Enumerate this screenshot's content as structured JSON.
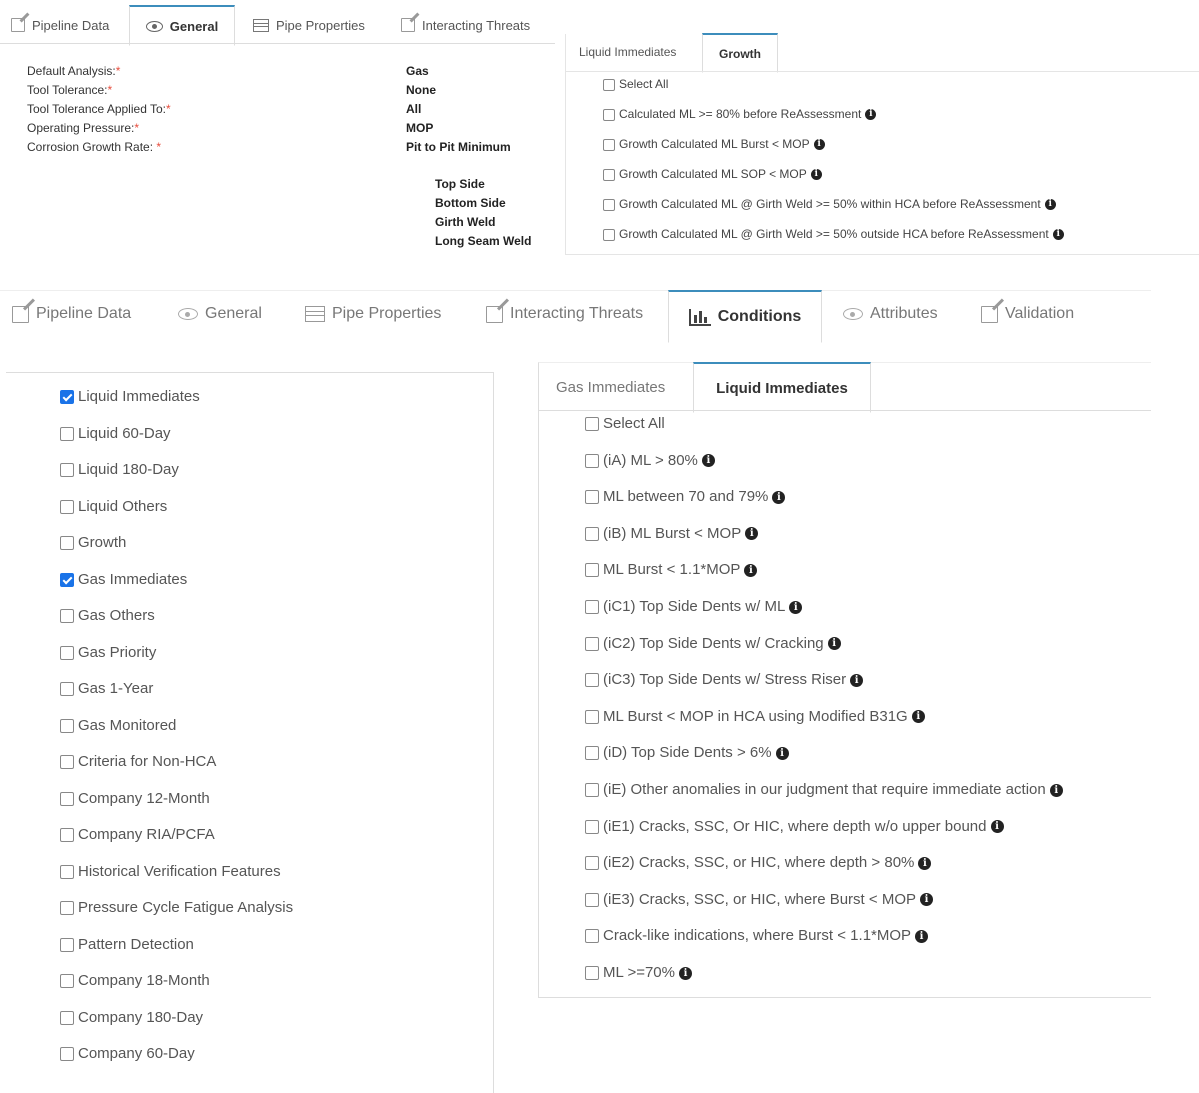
{
  "top_tabs": [
    "Pipeline Data",
    "General",
    "Pipe Properties",
    "Interacting Threats"
  ],
  "general_fields": [
    {
      "label": "Default Analysis:",
      "req": "*",
      "value": "Gas"
    },
    {
      "label": "Tool Tolerance:",
      "req": "*",
      "value": "None"
    },
    {
      "label": "Tool Tolerance Applied To:",
      "req": "*",
      "value": "All"
    },
    {
      "label": "Operating Pressure:",
      "req": "*",
      "value": "MOP"
    },
    {
      "label": "Corrosion Growth Rate: ",
      "req": "*",
      "value": "Pit to Pit Minimum"
    }
  ],
  "general_sub_values": [
    "Top Side",
    "Bottom Side",
    "Girth Weld",
    "Long Seam Weld"
  ],
  "growth_tabs": [
    "Liquid Immediates",
    "Growth"
  ],
  "growth_items": [
    "Select All",
    "Calculated ML >= 80% before ReAssessment",
    "Growth Calculated ML Burst < MOP",
    "Growth Calculated ML SOP < MOP",
    "Growth Calculated ML @ Girth Weld >= 50% within HCA before ReAssessment",
    "Growth Calculated ML @ Girth Weld >= 50% outside HCA before ReAssessment"
  ],
  "main_tabs": [
    "Pipeline Data",
    "General",
    "Pipe Properties",
    "Interacting Threats",
    "Conditions",
    "Attributes",
    "Validation"
  ],
  "conditions": [
    {
      "label": "Liquid Immediates",
      "checked": true
    },
    {
      "label": "Liquid 60-Day",
      "checked": false
    },
    {
      "label": "Liquid 180-Day",
      "checked": false
    },
    {
      "label": "Liquid Others",
      "checked": false
    },
    {
      "label": "Growth",
      "checked": false
    },
    {
      "label": "Gas Immediates",
      "checked": true
    },
    {
      "label": "Gas Others",
      "checked": false
    },
    {
      "label": "Gas Priority",
      "checked": false
    },
    {
      "label": "Gas 1-Year",
      "checked": false
    },
    {
      "label": "Gas Monitored",
      "checked": false
    },
    {
      "label": "Criteria for Non-HCA",
      "checked": false
    },
    {
      "label": "Company 12-Month",
      "checked": false
    },
    {
      "label": "Company RIA/PCFA",
      "checked": false
    },
    {
      "label": "Historical Verification Features",
      "checked": false
    },
    {
      "label": "Pressure Cycle Fatigue Analysis",
      "checked": false
    },
    {
      "label": "Pattern Detection",
      "checked": false
    },
    {
      "label": "Company 18-Month",
      "checked": false
    },
    {
      "label": "Company 180-Day",
      "checked": false
    },
    {
      "label": "Company 60-Day",
      "checked": false
    }
  ],
  "liquid_tabs": [
    "Gas Immediates",
    "Liquid Immediates"
  ],
  "liquid_items": [
    "Select All",
    "(iA) ML > 80%",
    "ML between 70 and 79%",
    "(iB) ML Burst < MOP",
    "ML Burst < 1.1*MOP",
    "(iC1) Top Side Dents w/ ML",
    "(iC2) Top Side Dents w/ Cracking",
    "(iC3) Top Side Dents w/ Stress Riser",
    "ML Burst < MOP in HCA using Modified B31G",
    "(iD) Top Side Dents > 6%",
    "(iE) Other anomalies in our judgment that require immediate action",
    "(iE1) Cracks, SSC, Or HIC, where depth w/o upper bound",
    "(iE2) Cracks, SSC, or HIC, where depth > 80%",
    "(iE3) Cracks, SSC, or HIC, where Burst < MOP",
    "Crack-like indications, where Burst < 1.1*MOP",
    "ML >=70%"
  ],
  "info_glyph": "i",
  "colors": {
    "accent": "#3c8dbc",
    "check": "#1a73e8",
    "required": "#e74c3c"
  }
}
